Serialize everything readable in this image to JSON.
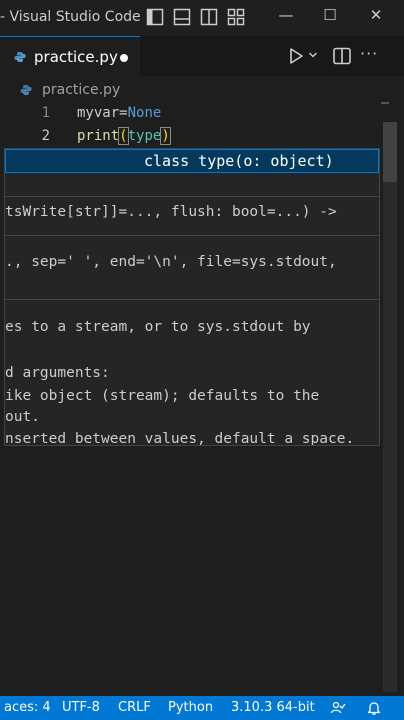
{
  "window": {
    "title": "- Visual Studio Code",
    "controls": {
      "minimize": "—",
      "maximize": "☐",
      "close": "✕"
    }
  },
  "tab": {
    "label": "practice.py",
    "icon": "python-file-icon",
    "modified": true
  },
  "breadcrumb": {
    "file": "practice.py"
  },
  "editor": {
    "lines": [
      {
        "number": "1",
        "tokens": {
          "ident": "myvar",
          "op": "=",
          "value": "None"
        }
      },
      {
        "number": "2",
        "tokens": {
          "fn": "print",
          "open": "(",
          "arg": "type",
          "close": ")"
        }
      }
    ]
  },
  "suggestion": {
    "signature": "class type(o: object)"
  },
  "hover": {
    "lines": [
      "tsWrite[str]]=..., flush: bool=...) ->",
      "., sep=' ', end='\\n', file=sys.stdout,",
      "es to a stream, or to sys.stdout by",
      "d arguments:",
      "ike object (stream); defaults to the",
      "out.",
      "nserted between values, default a space."
    ]
  },
  "status": {
    "spaces": "aces: 4",
    "encoding": "UTF-8",
    "eol": "CRLF",
    "language": "Python",
    "interpreter": "3.10.3 64-bit"
  },
  "colors": {
    "accent": "#0078d4",
    "editor_bg": "#1e1e1e",
    "keyword": "#569cd6",
    "function": "#dcdcaa"
  }
}
